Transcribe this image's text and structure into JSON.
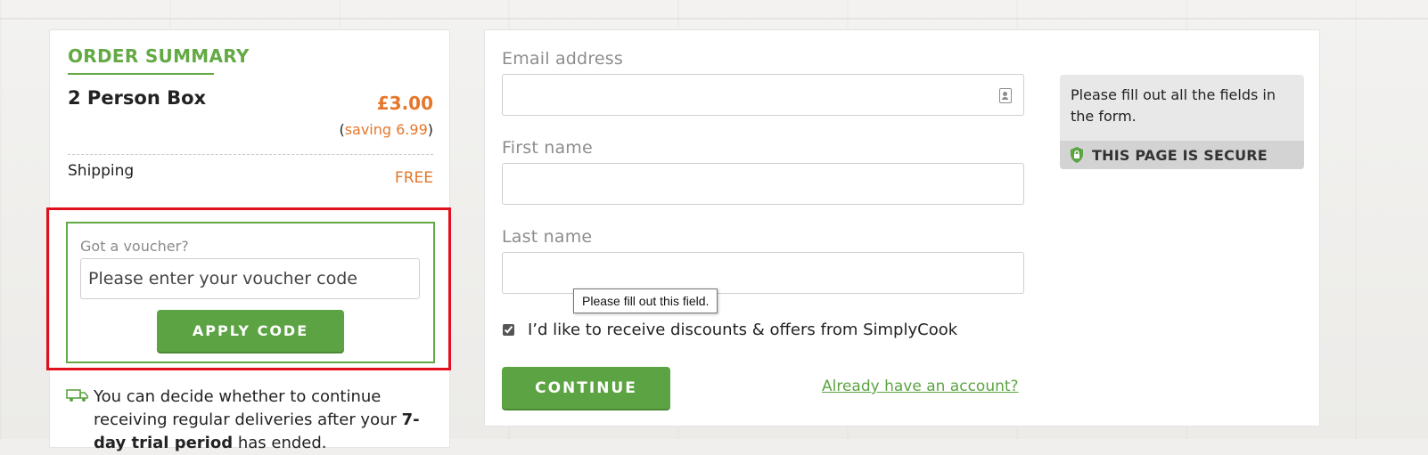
{
  "summary": {
    "title": "ORDER SUMMARY",
    "product_name": "2 Person Box",
    "price": "£3.00",
    "saving_open": "(",
    "saving_text": "saving 6.99",
    "saving_close": ")",
    "shipping_label": "Shipping",
    "shipping_value": "FREE"
  },
  "voucher": {
    "label": "Got a voucher?",
    "placeholder": "Please enter your voucher code",
    "apply_label": "APPLY CODE"
  },
  "delivery": {
    "icon": "truck-icon",
    "text_before": "You can decide whether to continue receiving regular deliveries after your ",
    "text_bold": "7-day trial period",
    "text_after": " has ended."
  },
  "form": {
    "email_label": "Email address",
    "first_name_label": "First name",
    "last_name_label": "Last name",
    "tooltip": "Please fill out this field.",
    "offers_label": "I’d like to receive discounts & offers from SimplyCook",
    "offers_checked": true,
    "continue_label": "CONTINUE",
    "account_link": "Already have an account?"
  },
  "info": {
    "message": "Please fill out all the fields in the form.",
    "secure_label": "THIS PAGE IS SECURE"
  },
  "colors": {
    "brand_green": "#5ca443",
    "price_orange": "#e6762a",
    "highlight_red": "#e0101c"
  }
}
